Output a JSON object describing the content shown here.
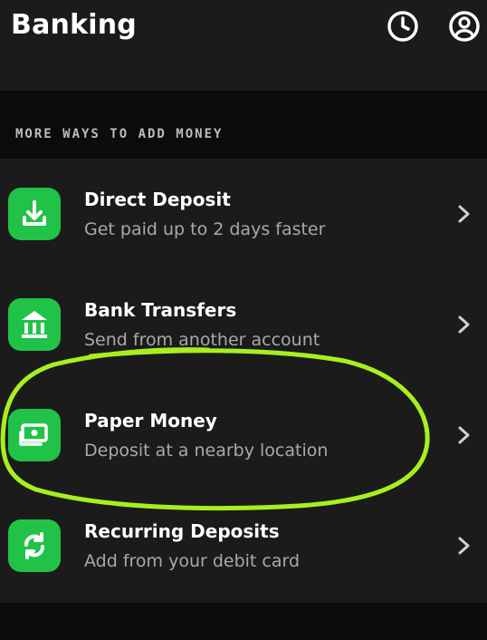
{
  "header": {
    "title": "Banking",
    "icons": [
      "clock-icon",
      "profile-icon"
    ]
  },
  "section": {
    "label": "MORE WAYS TO ADD MONEY"
  },
  "items": [
    {
      "title": "Direct Deposit",
      "subtitle": "Get paid up to 2 days faster",
      "icon": "download-icon"
    },
    {
      "title": "Bank Transfers",
      "subtitle": "Send from another account",
      "icon": "bank-icon"
    },
    {
      "title": "Paper Money",
      "subtitle": "Deposit at a nearby location",
      "icon": "cash-icon"
    },
    {
      "title": "Recurring Deposits",
      "subtitle": "Add from your debit card",
      "icon": "refresh-icon"
    }
  ],
  "colors": {
    "accent": "#20c347",
    "highlight": "#a8ef1f",
    "background": "#1b1b1b"
  }
}
